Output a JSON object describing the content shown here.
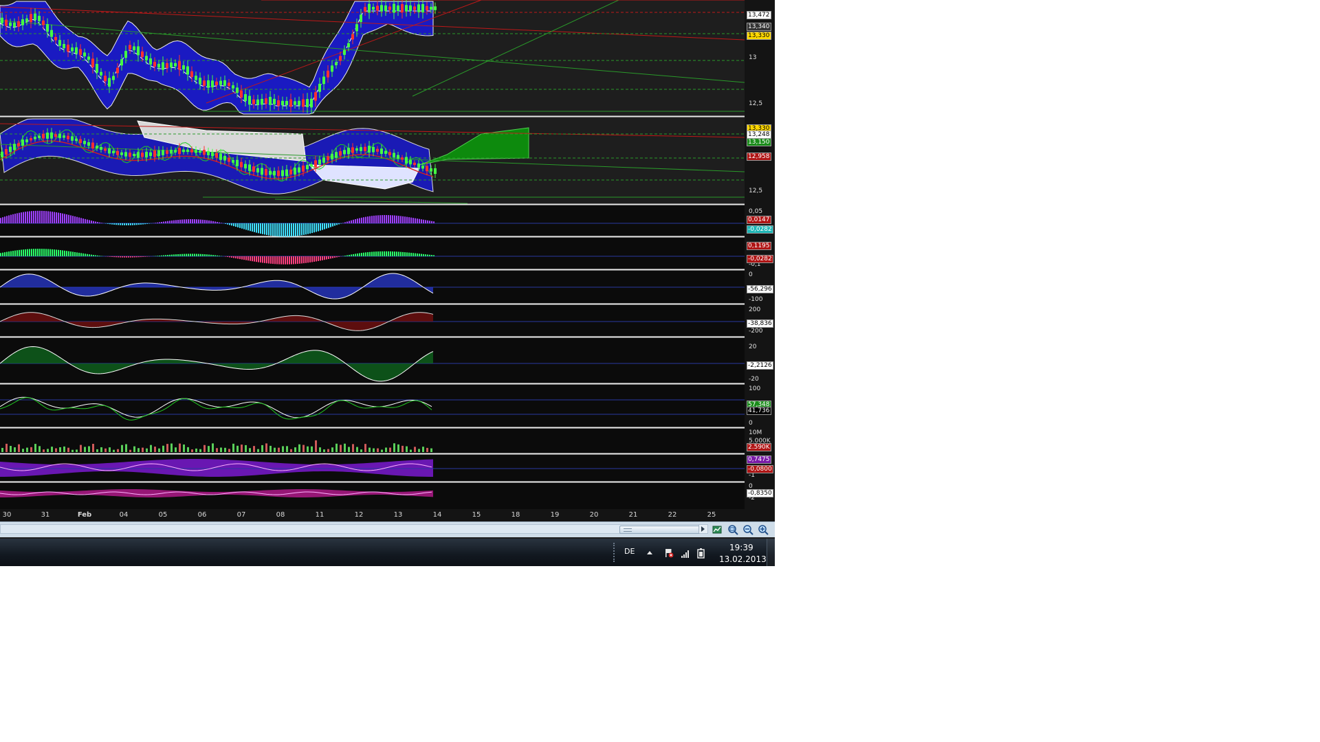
{
  "panes": [
    {
      "name": "price-bollinger",
      "labels": [
        "13",
        "12,5"
      ],
      "tags": [
        {
          "text": "13,472",
          "bg": "#ffffff",
          "fg": "#000000"
        },
        {
          "text": "13,340",
          "bg": "#333333",
          "fg": "#ffffff"
        },
        {
          "text": "13,330",
          "bg": "#ffd800",
          "fg": "#000000"
        }
      ]
    },
    {
      "name": "price-ichimoku",
      "labels": [
        "12,5"
      ],
      "tags": [
        {
          "text": "13,330",
          "bg": "#ffd800",
          "fg": "#000000"
        },
        {
          "text": "13,248",
          "bg": "#ffffff",
          "fg": "#000000"
        },
        {
          "text": "13,150",
          "bg": "#1a8c1a",
          "fg": "#ffffff"
        },
        {
          "text": "12,958",
          "bg": "#b01515",
          "fg": "#ffffff"
        }
      ]
    },
    {
      "name": "histogram-1",
      "labels": [
        "0,05"
      ],
      "tags": [
        {
          "text": "0,0147",
          "bg": "#b01515",
          "fg": "#ffffff"
        },
        {
          "text": "-0,0282",
          "bg": "#1fb6b6",
          "fg": "#ffffff"
        }
      ]
    },
    {
      "name": "macd",
      "labels": [
        "-0,1"
      ],
      "tags": [
        {
          "text": "0,1195",
          "bg": "#b01515",
          "fg": "#ffffff"
        },
        {
          "text": "-0,0282",
          "bg": "#b01515",
          "fg": "#ffffff"
        }
      ]
    },
    {
      "name": "williams",
      "labels": [
        "0",
        "-100"
      ],
      "tags": [
        {
          "text": "-56,296",
          "bg": "#ffffff",
          "fg": "#000000"
        }
      ]
    },
    {
      "name": "cci",
      "labels": [
        "200",
        "-200"
      ],
      "tags": [
        {
          "text": "-38,836",
          "bg": "#ffffff",
          "fg": "#000000"
        }
      ]
    },
    {
      "name": "momentum",
      "labels": [
        "20",
        "-20"
      ],
      "tags": [
        {
          "text": "-2,2126",
          "bg": "#ffffff",
          "fg": "#000000"
        }
      ]
    },
    {
      "name": "stochastic",
      "labels": [
        "100",
        "0"
      ],
      "tags": [
        {
          "text": "57,348",
          "bg": "#1a8c1a",
          "fg": "#ffffff"
        },
        {
          "text": "41,736",
          "bg": "#000000",
          "fg": "#ffffff"
        }
      ]
    },
    {
      "name": "volume",
      "labels": [
        "10M",
        "5.000K"
      ],
      "tags": [
        {
          "text": "2.590K",
          "bg": "#b01515",
          "fg": "#ffffff"
        }
      ]
    },
    {
      "name": "oscillator-purple",
      "labels": [
        "-1"
      ],
      "tags": [
        {
          "text": "0,7475",
          "bg": "#7a1aa8",
          "fg": "#ffffff"
        },
        {
          "text": "-0,0800",
          "bg": "#b01515",
          "fg": "#ffffff"
        }
      ]
    },
    {
      "name": "oscillator-magenta",
      "labels": [
        "0",
        "-2"
      ],
      "tags": [
        {
          "text": "-0,8350",
          "bg": "#ffffff",
          "fg": "#000000"
        }
      ]
    }
  ],
  "dates": [
    {
      "label": "30",
      "bold": false
    },
    {
      "label": "31",
      "bold": false
    },
    {
      "label": "Feb",
      "bold": true
    },
    {
      "label": "04",
      "bold": false
    },
    {
      "label": "05",
      "bold": false
    },
    {
      "label": "06",
      "bold": false
    },
    {
      "label": "07",
      "bold": false
    },
    {
      "label": "08",
      "bold": false
    },
    {
      "label": "11",
      "bold": false
    },
    {
      "label": "12",
      "bold": false
    },
    {
      "label": "13",
      "bold": false
    },
    {
      "label": "14",
      "bold": false
    },
    {
      "label": "15",
      "bold": false
    },
    {
      "label": "18",
      "bold": false
    },
    {
      "label": "19",
      "bold": false
    },
    {
      "label": "20",
      "bold": false
    },
    {
      "label": "21",
      "bold": false
    },
    {
      "label": "22",
      "bold": false
    },
    {
      "label": "25",
      "bold": false
    }
  ],
  "taskbar": {
    "language": "DE",
    "time": "19:39",
    "date": "13.02.2013"
  },
  "icons": {
    "zoom_fit": "zoom-fit-icon",
    "zoom_out": "zoom-out-icon",
    "zoom_in": "zoom-in-icon",
    "chart_settings": "chart-settings-icon"
  }
}
